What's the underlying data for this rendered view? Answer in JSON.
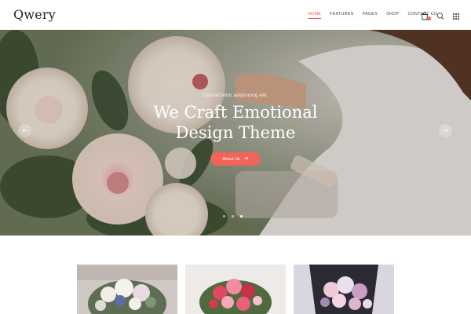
{
  "brand": {
    "logo": "Qwery"
  },
  "nav": {
    "items": [
      {
        "label": "HOME",
        "active": true
      },
      {
        "label": "FEATURES",
        "active": false
      },
      {
        "label": "PAGES",
        "active": false
      },
      {
        "label": "SHOP",
        "active": false
      },
      {
        "label": "CONTACT US",
        "active": false
      }
    ]
  },
  "header_icons": {
    "cart": {
      "icon": "shopping-bag-icon",
      "count": "0"
    },
    "search": {
      "icon": "search-icon"
    },
    "menu": {
      "icon": "grid-menu-icon"
    }
  },
  "hero": {
    "subtitle": "Consectetur adipiscing elit.",
    "title_line1": "We Craft Emotional",
    "title_line2": "Design Theme",
    "button_label": "About Us",
    "button_icon": "arrow-right-icon",
    "prev_icon": "arrow-left-icon",
    "next_icon": "arrow-right-icon",
    "slides": 3,
    "active_slide": 3
  },
  "colors": {
    "accent": "#f0645a",
    "nav_active": "#e84f4f",
    "text_dark": "#222222"
  },
  "cards": [
    {
      "name": "card-bouquet-white",
      "icon": "bouquet-image"
    },
    {
      "name": "card-bouquet-pink",
      "icon": "bouquet-image"
    },
    {
      "name": "card-bouquet-lavender",
      "icon": "bouquet-image"
    }
  ]
}
